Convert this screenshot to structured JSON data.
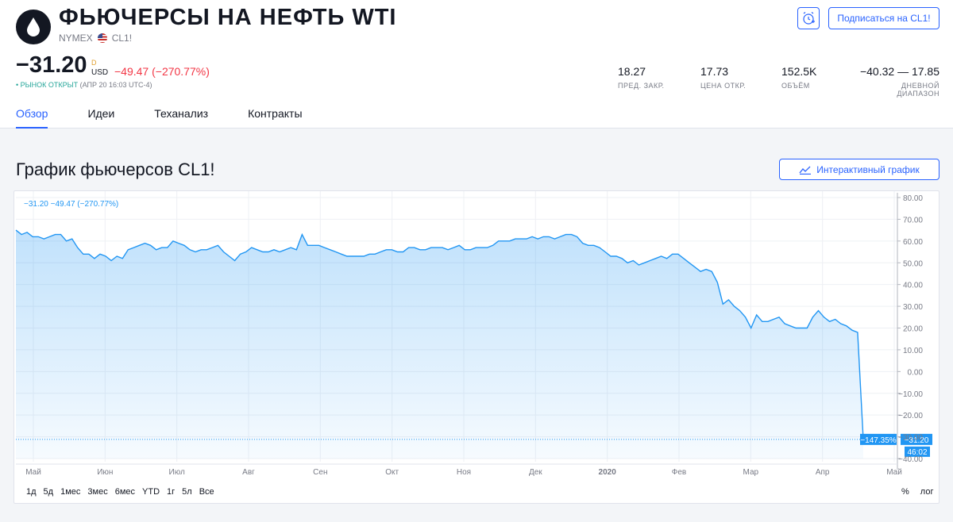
{
  "header": {
    "title": "ФЬЮЧЕРСЫ НА НЕФТЬ WTI",
    "exchange": "NYMEX",
    "symbol": "CL1!",
    "subscribe_label": "Подписаться на CL1!",
    "logo_icon": "oil-drop-icon",
    "alarm_icon": "alarm-clock-plus-icon"
  },
  "quote": {
    "price": "−31.20",
    "currency_marker": "D",
    "currency": "USD",
    "change": "−49.47 (−270.77%)",
    "market_status": "• РЫНОК ОТКРЫТ",
    "market_time": "(АПР 20 16:03 UTC-4)"
  },
  "stats": [
    {
      "value": "18.27",
      "label": "ПРЕД. ЗАКР."
    },
    {
      "value": "17.73",
      "label": "ЦЕНА ОТКР."
    },
    {
      "value": "152.5K",
      "label": "ОБЪЁМ"
    },
    {
      "value": "−40.32 — 17.85",
      "label": "ДНЕВНОЙ ДИАПАЗОН"
    }
  ],
  "tabs": [
    {
      "label": "Обзор",
      "active": true
    },
    {
      "label": "Идеи",
      "active": false
    },
    {
      "label": "Теханализ",
      "active": false
    },
    {
      "label": "Контракты",
      "active": false
    }
  ],
  "section": {
    "title": "График фьючерсов CL1!",
    "interactive_label": "Интерактивный график"
  },
  "ranges": [
    "1д",
    "5д",
    "1мес",
    "3мес",
    "6мес",
    "YTD",
    "1г",
    "5л",
    "Все"
  ],
  "scale_options": [
    "%",
    "лог"
  ],
  "colors": {
    "accent": "#2962ff",
    "line": "#2196f3",
    "negative": "#f23645",
    "positive": "#26a69a"
  },
  "chart_data": {
    "type": "area",
    "legend_text": "−31.20  −49.47 (−270.77%)",
    "y_ticks": [
      "80.00",
      "70.00",
      "60.00",
      "50.00",
      "40.00",
      "30.00",
      "20.00",
      "10.00",
      "0.00",
      "−10.00",
      "−20.00",
      "−30.00",
      "−40.00"
    ],
    "ylim": [
      -40,
      80
    ],
    "x_ticks": [
      "Май",
      "Июн",
      "Июл",
      "Авг",
      "Сен",
      "Окт",
      "Ноя",
      "Дек",
      "2020",
      "Фев",
      "Мар",
      "Апр",
      "Май"
    ],
    "last_price_label": "−31.20",
    "last_pct_label": "−147.35%",
    "countdown_label": "46:02",
    "grid": true,
    "series": [
      {
        "values": [
          65,
          63,
          64,
          62,
          62,
          61,
          62,
          63,
          63,
          60,
          61,
          57,
          54,
          54,
          52,
          54,
          53,
          51,
          53,
          52,
          56,
          57,
          58,
          59,
          58,
          56,
          57,
          57,
          60,
          59,
          58,
          56,
          55,
          56,
          56,
          57,
          58,
          55,
          53,
          51,
          54,
          55,
          57,
          56,
          55,
          55,
          56,
          55,
          56,
          57,
          56,
          63,
          58,
          58,
          58,
          57,
          56,
          55,
          54,
          53,
          53,
          53,
          53,
          54,
          54,
          55,
          56,
          56,
          55,
          55,
          57,
          57,
          56,
          56,
          57,
          57,
          57,
          56,
          57,
          58,
          56,
          56,
          57,
          57,
          57,
          58,
          60,
          60,
          60,
          61,
          61,
          61,
          62,
          61,
          62,
          62,
          61,
          62,
          63,
          63,
          62,
          59,
          58,
          58,
          57,
          55,
          53,
          53,
          52,
          50,
          51,
          49,
          50,
          51,
          52,
          53,
          52,
          54,
          54,
          52,
          50,
          48,
          46,
          47,
          46,
          41,
          31,
          33,
          30,
          28,
          25,
          20,
          26,
          23,
          23,
          24,
          25,
          22,
          21,
          20,
          20,
          20,
          25,
          28,
          25,
          23,
          24,
          22,
          21,
          19,
          18,
          -31.2
        ]
      }
    ]
  }
}
